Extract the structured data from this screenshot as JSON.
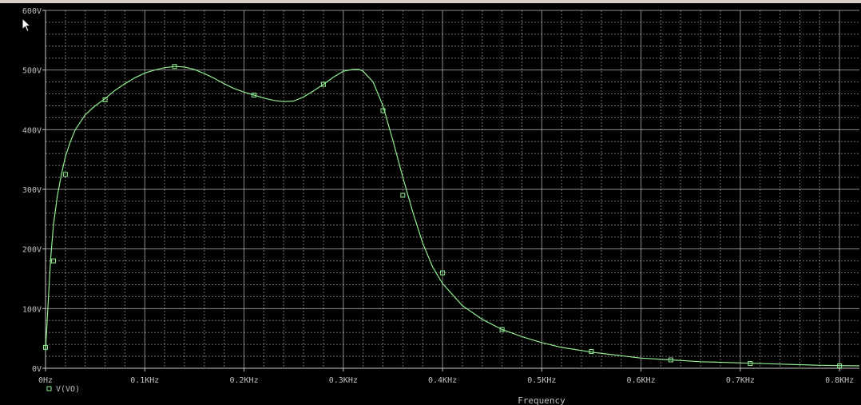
{
  "chart_data": {
    "type": "line",
    "title": "",
    "xlabel": "Frequency",
    "ylabel": "",
    "xlim": [
      0,
      0.82
    ],
    "ylim": [
      0,
      600
    ],
    "x_unit": "KHz",
    "y_unit": "V",
    "grid": true,
    "background": "#000000",
    "grid_color": "#c8c8c8",
    "x_ticks": [
      "0Hz",
      "0.1KHz",
      "0.2KHz",
      "0.3KHz",
      "0.4KHz",
      "0.5KHz",
      "0.6KHz",
      "0.7KHz",
      "0.8KHz"
    ],
    "x_tick_values": [
      0,
      0.1,
      0.2,
      0.3,
      0.4,
      0.5,
      0.6,
      0.7,
      0.8
    ],
    "y_ticks": [
      "0V",
      "100V",
      "200V",
      "300V",
      "400V",
      "500V",
      "600V"
    ],
    "y_tick_values": [
      0,
      100,
      200,
      300,
      400,
      500,
      600
    ],
    "series": [
      {
        "name": "V(VO)",
        "color": "#90ee90",
        "x": [
          0.0,
          0.002,
          0.005,
          0.008,
          0.012,
          0.016,
          0.02,
          0.025,
          0.03,
          0.04,
          0.05,
          0.06,
          0.07,
          0.08,
          0.09,
          0.1,
          0.11,
          0.12,
          0.13,
          0.14,
          0.15,
          0.16,
          0.17,
          0.18,
          0.19,
          0.2,
          0.21,
          0.22,
          0.23,
          0.24,
          0.25,
          0.26,
          0.27,
          0.28,
          0.29,
          0.3,
          0.31,
          0.316,
          0.32,
          0.33,
          0.34,
          0.35,
          0.36,
          0.37,
          0.38,
          0.39,
          0.4,
          0.42,
          0.44,
          0.46,
          0.48,
          0.5,
          0.52,
          0.55,
          0.58,
          0.6,
          0.63,
          0.66,
          0.7,
          0.74,
          0.78,
          0.82
        ],
        "y": [
          30,
          90,
          180,
          240,
          290,
          325,
          355,
          380,
          400,
          425,
          440,
          452,
          466,
          477,
          487,
          495,
          500,
          504,
          506,
          505,
          501,
          494,
          486,
          477,
          469,
          463,
          458,
          453,
          449,
          447,
          448,
          455,
          465,
          476,
          488,
          498,
          501,
          501,
          498,
          480,
          440,
          382,
          320,
          262,
          210,
          170,
          142,
          105,
          82,
          65,
          53,
          43,
          35,
          27,
          21,
          17,
          14,
          11,
          9,
          7,
          5,
          4
        ],
        "marker_x": [
          0.0,
          0.008,
          0.02,
          0.06,
          0.13,
          0.21,
          0.28,
          0.34,
          0.36,
          0.4,
          0.46,
          0.55,
          0.63,
          0.71,
          0.8
        ],
        "marker_y": [
          35,
          180,
          325,
          450,
          506,
          458,
          476,
          432,
          290,
          160,
          65,
          28,
          14,
          8,
          4
        ]
      }
    ],
    "legend": {
      "position": "bottom-left",
      "label": "V(VO)"
    }
  }
}
